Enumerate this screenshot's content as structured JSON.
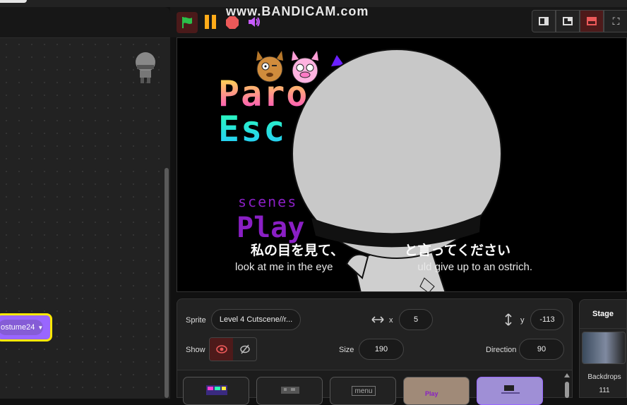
{
  "watermark": "www.BANDICAM.com",
  "code_area": {
    "costume_block": "ostume24"
  },
  "stage": {
    "title_line1": "Paro",
    "title_line2": "Esc",
    "menu_scenes": "scenes",
    "menu_play": "Play",
    "subtitle_jp": "私の目を見て、　　　　　と言ってください",
    "subtitle_en": "look at me in the eye　　　　　　　　uld give up to an ostrich."
  },
  "sprite_info": {
    "sprite_label": "Sprite",
    "sprite_name": "Level 4 Cutscene//r...",
    "x_label": "x",
    "x_value": "5",
    "y_label": "y",
    "y_value": "-113",
    "show_label": "Show",
    "size_label": "Size",
    "size_value": "190",
    "direction_label": "Direction",
    "direction_value": "90"
  },
  "sprite_tiles": [
    {
      "name": "tile-1"
    },
    {
      "name": "tile-2"
    },
    {
      "name": "tile-3",
      "text": "menu"
    },
    {
      "name": "tile-4",
      "text": "Play"
    },
    {
      "name": "tile-5"
    }
  ],
  "stage_pane": {
    "title": "Stage",
    "backdrops_label": "Backdrops",
    "backdrops_count": "111"
  },
  "colors": {
    "flag_green": "#2bbf4a",
    "pause_orange": "#ffab19",
    "stop_red": "#ec5959",
    "highlight_yellow": "#ffe900",
    "looks_purple": "#9966ff"
  }
}
